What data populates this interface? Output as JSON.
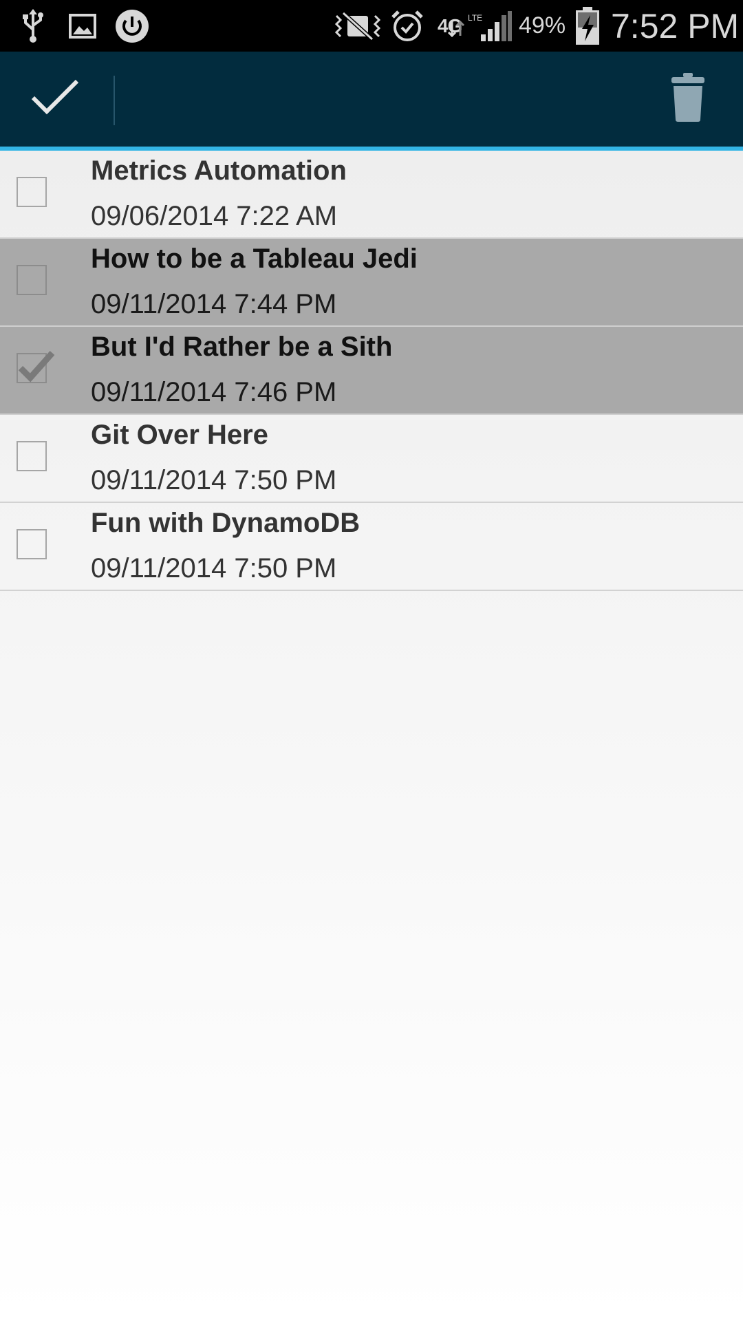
{
  "status_bar": {
    "battery": "49%",
    "time": "7:52 PM",
    "network": "4G",
    "network_sub": "LTE",
    "icons": [
      "usb-icon",
      "image-icon",
      "power-icon",
      "mute-icon",
      "alarm-icon",
      "signal-icon",
      "battery-charging-icon"
    ]
  },
  "action_bar": {
    "done_icon": "checkmark-icon",
    "delete_icon": "trash-icon",
    "background": "#022c3e",
    "accent": "#33b5e5"
  },
  "notes": [
    {
      "title": "Metrics Automation",
      "date": "09/06/2014 7:22 AM",
      "selected": false,
      "checked": false
    },
    {
      "title": "How to be a Tableau Jedi",
      "date": "09/11/2014 7:44 PM",
      "selected": true,
      "checked": false
    },
    {
      "title": "But I'd Rather be a Sith",
      "date": "09/11/2014 7:46 PM",
      "selected": true,
      "checked": true
    },
    {
      "title": "Git Over Here",
      "date": "09/11/2014 7:50 PM",
      "selected": false,
      "checked": false
    },
    {
      "title": "Fun with DynamoDB",
      "date": "09/11/2014 7:50 PM",
      "selected": false,
      "checked": false
    }
  ]
}
